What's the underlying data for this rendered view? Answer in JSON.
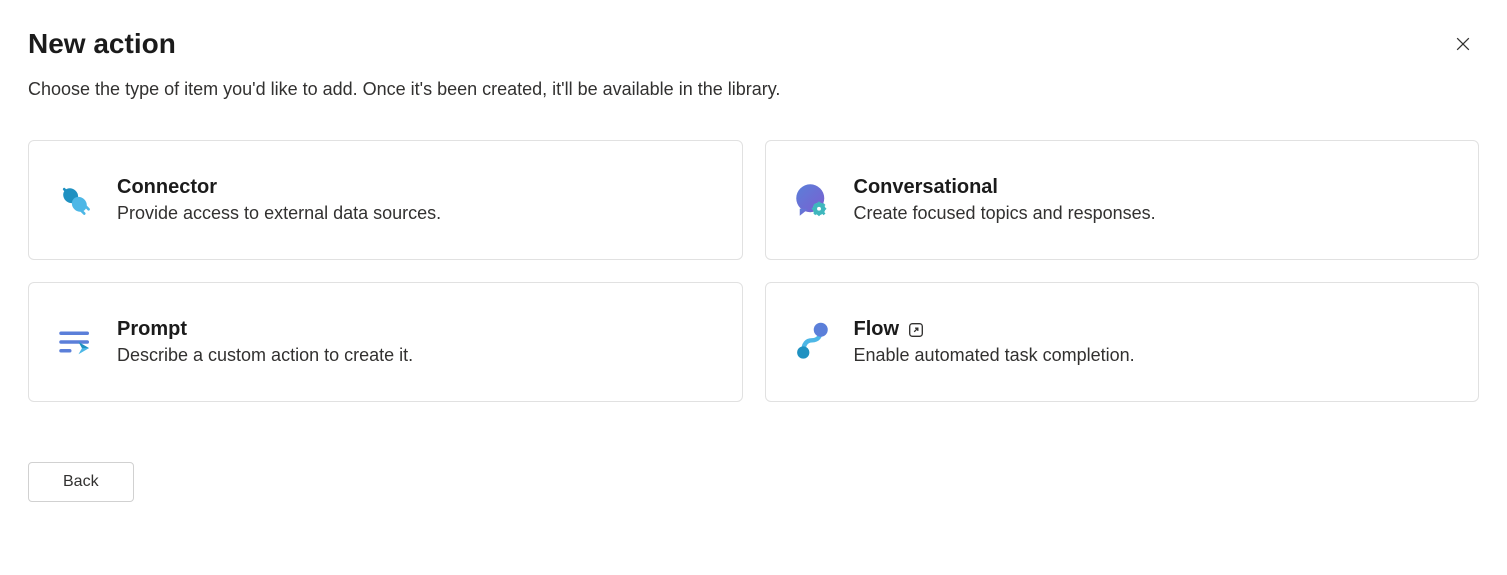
{
  "header": {
    "title": "New action",
    "subtitle": "Choose the type of item you'd like to add. Once it's been created, it'll be available in the library."
  },
  "cards": {
    "connector": {
      "title": "Connector",
      "desc": "Provide access to external data sources."
    },
    "conversational": {
      "title": "Conversational",
      "desc": "Create focused topics and responses."
    },
    "prompt": {
      "title": "Prompt",
      "desc": "Describe a custom action to create it."
    },
    "flow": {
      "title": "Flow",
      "desc": "Enable automated task completion."
    }
  },
  "footer": {
    "back": "Back"
  }
}
